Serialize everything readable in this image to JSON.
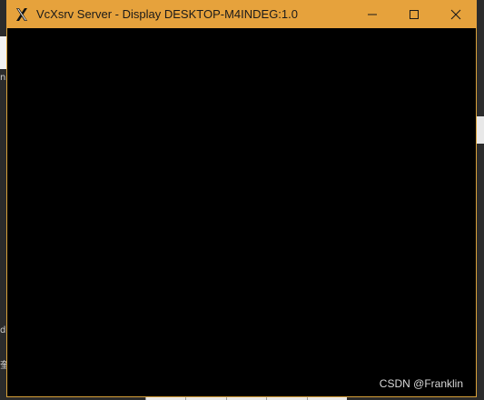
{
  "window": {
    "title": "VcXsrv Server - Display DESKTOP-M4INDEG:1.0",
    "icon": "x-logo-icon",
    "titlebar_color": "#e6a23c",
    "client_color": "#000000"
  },
  "controls": {
    "minimize": "minimize-icon",
    "maximize": "maximize-icon",
    "close": "close-icon"
  },
  "background_fragments": {
    "left_top_text": "ns",
    "left_lower_text": "dc",
    "left_bottom_text": "奎"
  },
  "watermark": "CSDN @Franklin"
}
